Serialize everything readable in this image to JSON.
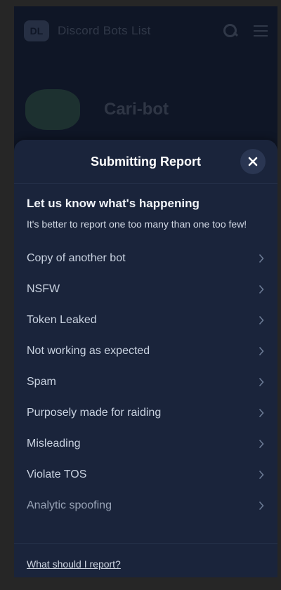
{
  "background": {
    "logo_text": "DL",
    "brand": "Discord Bots List",
    "bot_name": "Cari-bot"
  },
  "modal": {
    "title": "Submitting Report",
    "intro_title": "Let us know what's happening",
    "intro_subtitle": "It's better to report one too many than one too few!",
    "reasons": [
      {
        "label": "Copy of another bot"
      },
      {
        "label": "NSFW"
      },
      {
        "label": "Token Leaked"
      },
      {
        "label": "Not working as expected"
      },
      {
        "label": "Spam"
      },
      {
        "label": "Purposely made for raiding"
      },
      {
        "label": "Misleading"
      },
      {
        "label": "Violate TOS"
      },
      {
        "label": "Analytic spoofing"
      }
    ],
    "footer_link": "What should I report?"
  },
  "icons": {
    "close": "close-icon",
    "chevron": "chevron-right-icon",
    "search": "search-icon",
    "menu": "menu-icon"
  },
  "colors": {
    "page_bg": "#0f1626",
    "sheet_bg": "#1a243b",
    "close_bg": "#2a3652",
    "text_primary": "#ffffff",
    "text_item": "#c9d2e0"
  }
}
